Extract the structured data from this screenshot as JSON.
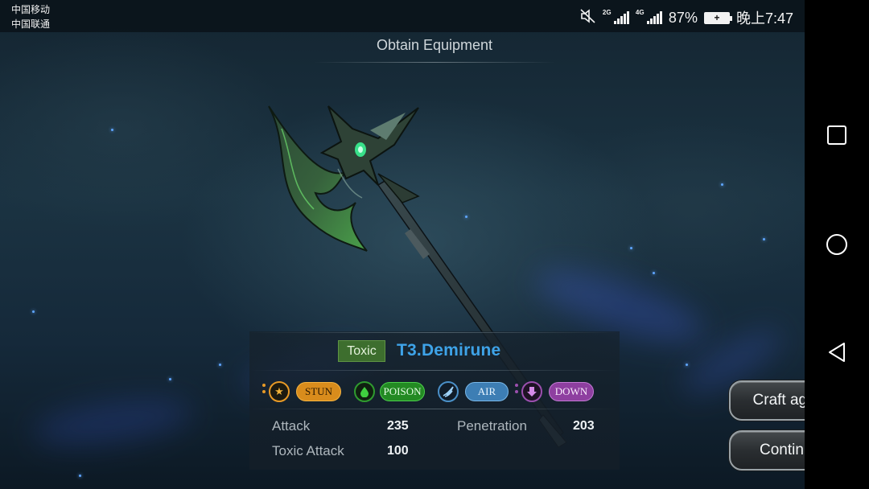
{
  "status_bar": {
    "carrier_1": "中国移动",
    "carrier_2": "中国联通",
    "net_1": "2G",
    "net_2": "4G",
    "battery_pct": "87%",
    "time": "晚上7:47",
    "icons": [
      "mute-icon",
      "signal-icon",
      "signal-icon",
      "battery-icon"
    ]
  },
  "screen": {
    "title": "Obtain Equipment"
  },
  "item": {
    "element": "Toxic",
    "name": "T3.Demirune",
    "name_color": "#3ea3e8",
    "element_color": "#3d6e2e"
  },
  "effects": [
    {
      "label": "STUN",
      "icon": "stun-icon",
      "color": "#e89a26"
    },
    {
      "label": "POISON",
      "icon": "poison-drop-icon",
      "color": "#2f9b2f"
    },
    {
      "label": "AIR",
      "icon": "air-wing-icon",
      "color": "#4a90c8"
    },
    {
      "label": "DOWN",
      "icon": "down-arrow-icon",
      "color": "#9b4fae"
    }
  ],
  "stats": [
    {
      "label": "Attack",
      "value": "235"
    },
    {
      "label": "Penetration",
      "value": "203"
    },
    {
      "label": "Toxic Attack",
      "value": "100"
    }
  ],
  "actions": {
    "craft_again": "Craft again",
    "continue": "Continue"
  },
  "nav": {
    "icons": [
      "recents-square-icon",
      "home-circle-icon",
      "back-triangle-icon"
    ]
  }
}
